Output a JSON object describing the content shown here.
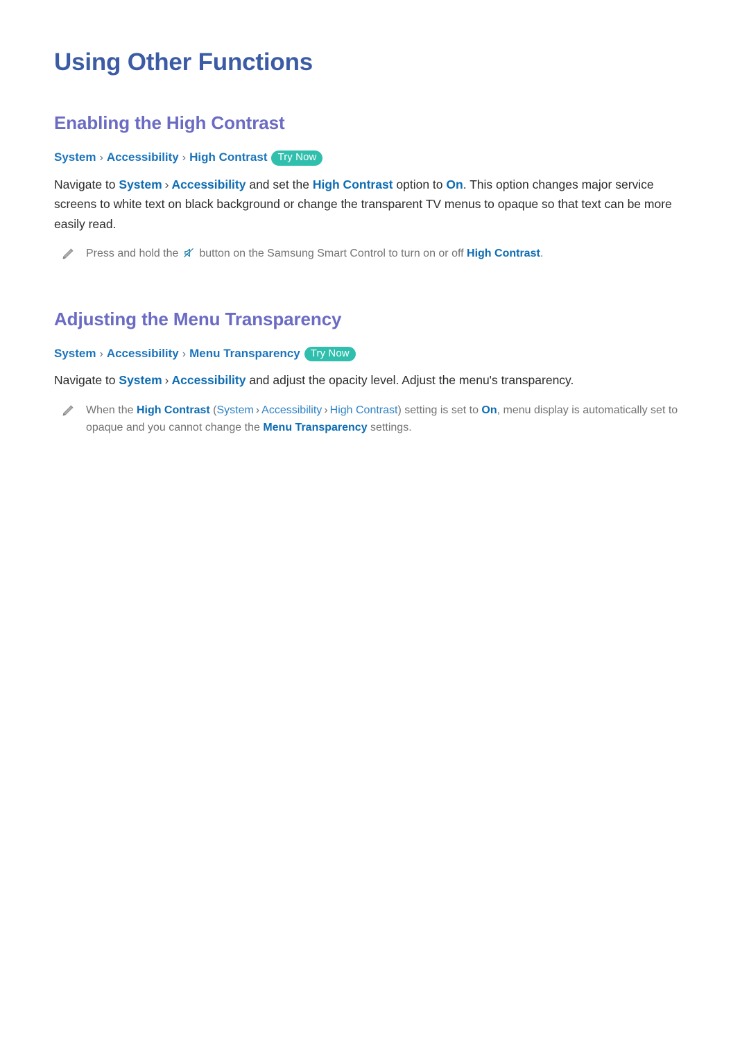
{
  "page": {
    "title": "Using Other Functions"
  },
  "colors": {
    "page_title": "#3b5ba5",
    "section_heading": "#6b6bc4",
    "breadcrumb_link": "#1b74bb",
    "inline_highlight": "#0d6cb3",
    "try_now_badge": "#31bfad",
    "body_text": "#2b2b2b",
    "note_text": "#737373",
    "pencil_icon": "#9a9a9a",
    "mute_icon": "#1f7fa8"
  },
  "sections": [
    {
      "heading": "Enabling the High Contrast",
      "breadcrumb": {
        "crumbs": [
          "System",
          "Accessibility",
          "High Contrast"
        ],
        "separator": "›",
        "badge": "Try Now"
      },
      "paragraph": {
        "p1": "Navigate to ",
        "link1": "System",
        "sep1": "›",
        "link2": "Accessibility",
        "p2": " and set the ",
        "link3": "High Contrast",
        "p3": " option to ",
        "link4": "On",
        "p4": ". This option changes major service screens to white text on black background or change the transparent TV menus to opaque so that text can be more easily read."
      },
      "note": {
        "icon": "pencil-icon",
        "t1": "Press and hold the ",
        "inline_icon": "mute-icon",
        "t2": " button on the Samsung Smart Control to turn on or off ",
        "hl1": "High Contrast",
        "t3": "."
      }
    },
    {
      "heading": "Adjusting the Menu Transparency",
      "breadcrumb": {
        "crumbs": [
          "System",
          "Accessibility",
          "Menu Transparency"
        ],
        "separator": "›",
        "badge": "Try Now"
      },
      "paragraph": {
        "p1": "Navigate to ",
        "link1": "System",
        "sep1": "›",
        "link2": "Accessibility",
        "p2": " and adjust the opacity level. Adjust the menu's transparency."
      },
      "note": {
        "icon": "pencil-icon",
        "t1": "When the ",
        "hl1": "High Contrast",
        "t2": " (",
        "hl2": "System",
        "sep1": "›",
        "hl3": "Accessibility",
        "sep2": "›",
        "hl4": "High Contrast",
        "t3": ") setting is set to ",
        "hl5": "On",
        "t4": ", menu display is automatically set to opaque and you cannot change the ",
        "hl6": "Menu Transparency",
        "t5": " settings."
      }
    }
  ]
}
